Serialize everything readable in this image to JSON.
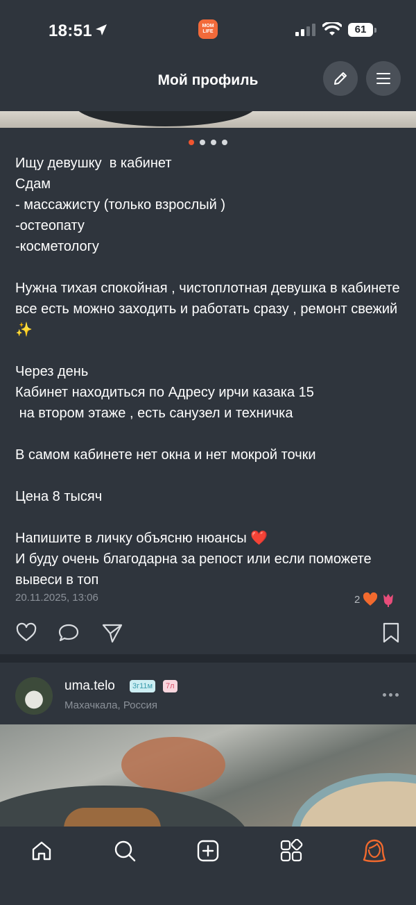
{
  "status_bar": {
    "time": "18:51",
    "battery": "61",
    "app_badge_text": "MOM LIFE"
  },
  "header": {
    "title": "Мой профиль"
  },
  "carousel": {
    "current_index": 1,
    "total": 4
  },
  "post": {
    "text": "Ищу девушку  в кабинет\nСдам\n- массажисту (только взрослый )\n-остеопату\n-косметологу\n\nНужна тихая спокойная , чистоплотная девушка в кабинете все есть можно заходить и работать сразу , ремонт свежий ✨\n\nЧерез день\nКабинет находиться по Адресу ирчи казака 15\n на втором этаже , есть санузел и техничка\n\nВ самом кабинете нет окна и нет мокрой точки\n\nЦена 8 тысяч\n\nНапишите в личку объясню нюансы ❤️\nИ буду очень благодарна за репост или если поможете вывеси в топ",
    "date": "20.11.2025, 13:06",
    "reaction_count": "2"
  },
  "next_post": {
    "username": "uma.telo",
    "badge_age": "3г11м",
    "badge_kid": "7л",
    "location": "Махачкала, Россия"
  },
  "colors": {
    "accent": "#f0552f",
    "background": "#2f353d",
    "muted": "#8b9199"
  },
  "icons": [
    "pencil-icon",
    "menu-icon",
    "like-icon",
    "comment-icon",
    "share-icon",
    "bookmark-icon",
    "home-icon",
    "search-icon",
    "add-icon",
    "categories-icon",
    "profile-icon"
  ]
}
